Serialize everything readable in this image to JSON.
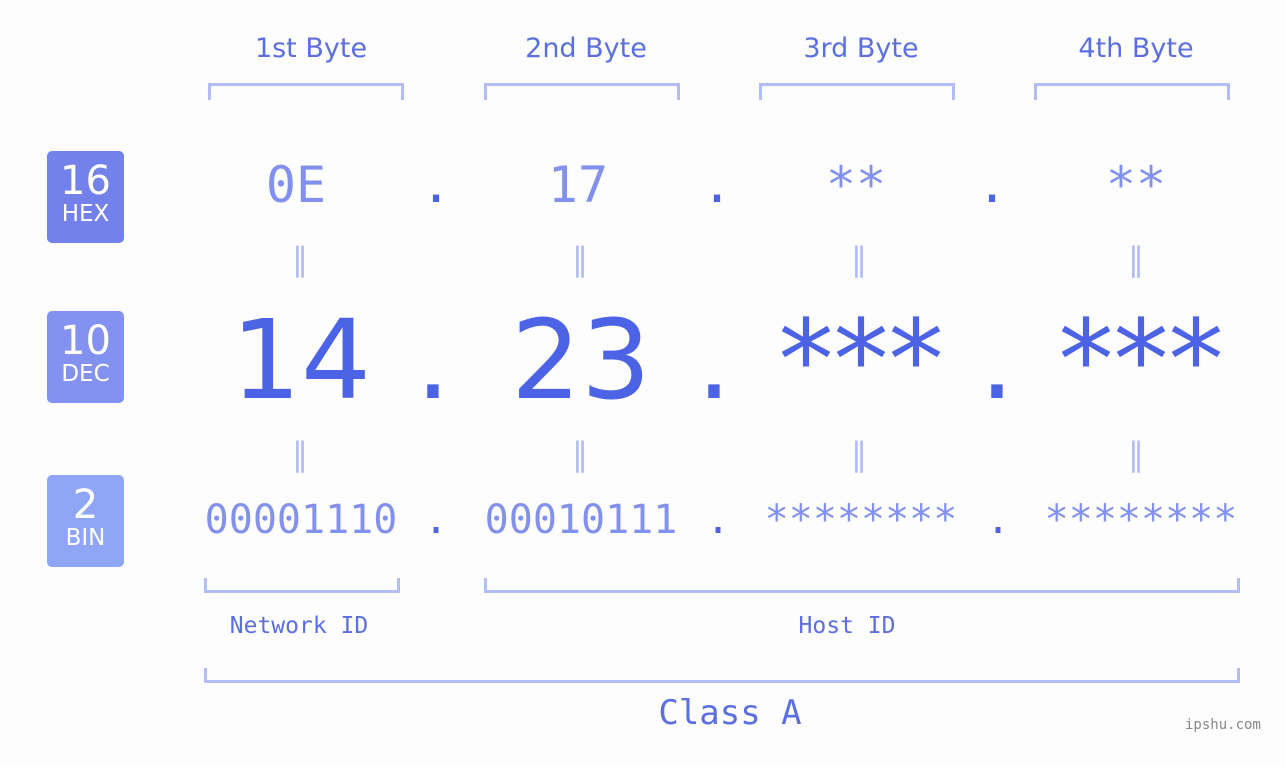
{
  "headers": [
    "1st Byte",
    "2nd Byte",
    "3rd Byte",
    "4th Byte"
  ],
  "badges": {
    "hex": {
      "num": "16",
      "label": "HEX",
      "color": "#7382eb"
    },
    "dec": {
      "num": "10",
      "label": "DEC",
      "color": "#8392f0"
    },
    "bin": {
      "num": "2",
      "label": "BIN",
      "color": "#8fa6f7"
    }
  },
  "hex": [
    "0E",
    "17",
    "**",
    "**"
  ],
  "dec": [
    "14",
    "23",
    "***",
    "***"
  ],
  "bin": [
    "00001110",
    "00010111",
    "********",
    "********"
  ],
  "separator": ".",
  "equals": "=",
  "network_label": "Network ID",
  "host_label": "Host ID",
  "class_label": "Class A",
  "watermark": "ipshu.com"
}
